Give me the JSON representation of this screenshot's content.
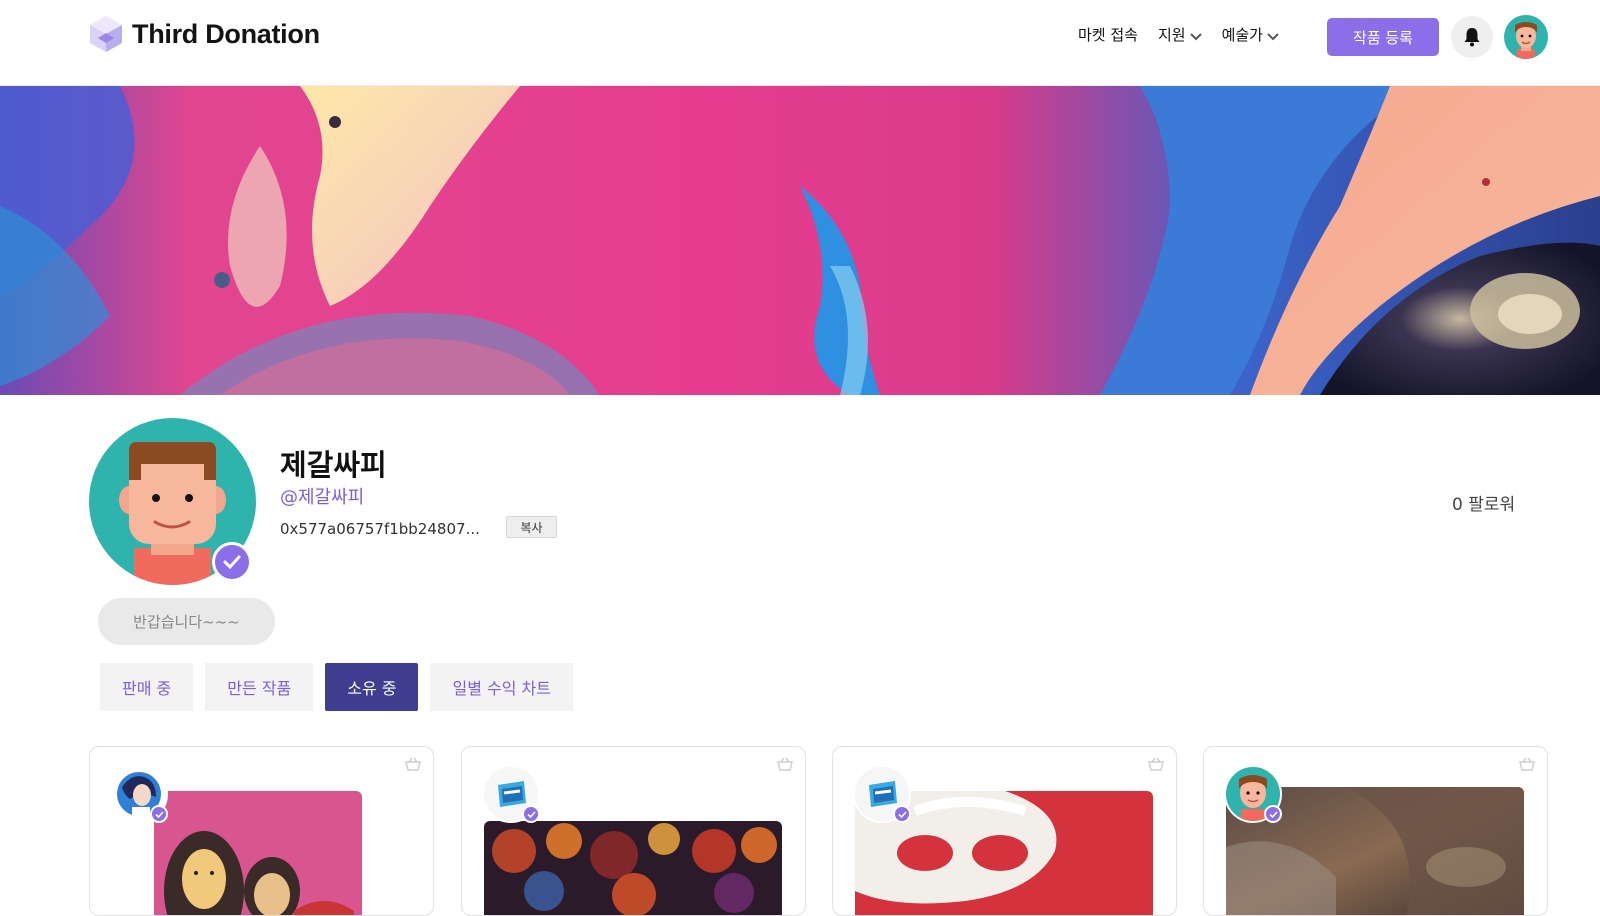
{
  "header": {
    "brand": "Third Donation",
    "nav": [
      {
        "label": "마켓 접속",
        "dropdown": false
      },
      {
        "label": "지원",
        "dropdown": true
      },
      {
        "label": "예술가",
        "dropdown": true
      }
    ],
    "register_label": "작품 등록",
    "bell_icon": "bell-icon",
    "accent": "#8b6ee8"
  },
  "profile": {
    "name": "제갈싸피",
    "handle": "@제갈싸피",
    "address": "0x577a06757f1bb24807...",
    "copy_label": "복사",
    "followers": "0 팔로워",
    "bio": "반갑습니다~~~",
    "verified": true
  },
  "tabs": [
    {
      "label": "판매 중",
      "active": false
    },
    {
      "label": "만든 작품",
      "active": false
    },
    {
      "label": "소유 중",
      "active": true
    },
    {
      "label": "일별 수익 차트",
      "active": false
    }
  ],
  "cards": [
    {
      "creator_icon": "creator-avatar-icon",
      "verified": true,
      "basket_icon": "basket-icon"
    },
    {
      "creator_icon": "ssafy-logo-icon",
      "verified": true,
      "basket_icon": "basket-icon"
    },
    {
      "creator_icon": "ssafy-logo-icon",
      "verified": true,
      "basket_icon": "basket-icon"
    },
    {
      "creator_icon": "user-avatar-icon",
      "verified": true,
      "basket_icon": "basket-icon"
    }
  ],
  "colors": {
    "accent": "#8b6ee8",
    "tab_active": "#3f3d8f",
    "tab_text": "#7a5ee0"
  }
}
